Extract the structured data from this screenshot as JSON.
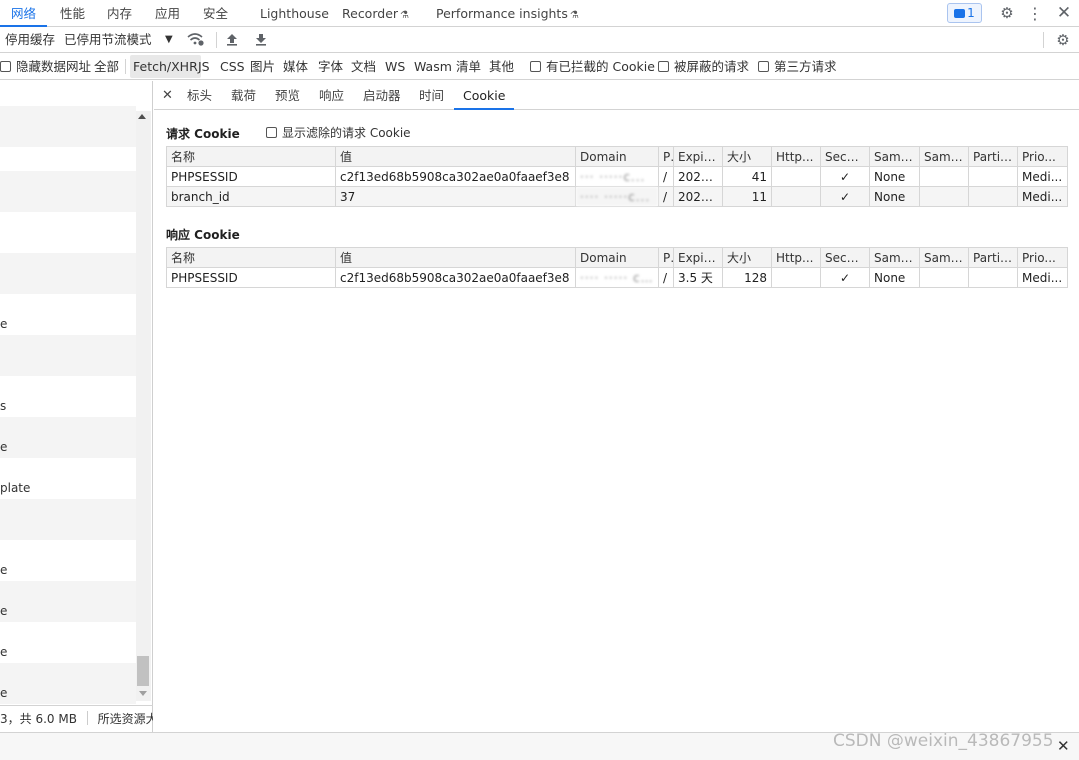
{
  "main_tabs": [
    {
      "label": "网络",
      "active": true
    },
    {
      "label": "性能"
    },
    {
      "label": "内存"
    },
    {
      "label": "应用"
    },
    {
      "label": "安全"
    },
    {
      "label": "Lighthouse"
    },
    {
      "label": "Recorder"
    },
    {
      "label": "Performance insights"
    }
  ],
  "issues_badge": "1",
  "toolbar": {
    "disable_cache": "停用缓存",
    "throttling": "已停用节流模式"
  },
  "filters": [
    {
      "label": "隐藏数据网址",
      "checkbox": true
    },
    {
      "label": "全部"
    },
    {
      "label": "Fetch/XHR",
      "selected": true
    },
    {
      "label": "JS"
    },
    {
      "label": "CSS"
    },
    {
      "label": "图片"
    },
    {
      "label": "媒体"
    },
    {
      "label": "字体"
    },
    {
      "label": "文档"
    },
    {
      "label": "WS"
    },
    {
      "label": "Wasm"
    },
    {
      "label": "清单"
    },
    {
      "label": "其他"
    },
    {
      "label": "有已拦截的 Cookie",
      "checkbox": true
    },
    {
      "label": "被屏蔽的请求",
      "checkbox": true
    },
    {
      "label": "第三方请求",
      "checkbox": true
    }
  ],
  "request_list_fragments": [
    "e",
    "s",
    "e",
    "plate",
    "e",
    "e",
    "e",
    "e"
  ],
  "left_status": "3，共 6.0 MB",
  "left_status2": "所选资源大小",
  "detail_tabs": [
    {
      "label": "标头"
    },
    {
      "label": "载荷"
    },
    {
      "label": "预览"
    },
    {
      "label": "响应"
    },
    {
      "label": "启动器"
    },
    {
      "label": "时间"
    },
    {
      "label": "Cookie",
      "active": true
    }
  ],
  "request_cookies": {
    "title": "请求 Cookie",
    "show_filtered": "显示滤除的请求 Cookie",
    "columns": [
      "名称",
      "值",
      "Domain",
      "P",
      "Expire...",
      "大小",
      "Http...",
      "Secure",
      "Same...",
      "Same...",
      "Partiti...",
      "Prio..."
    ],
    "rows": [
      [
        "PHPSESSID",
        "c2f13ed68b5908ca302ae0a0faaef3e8",
        "··· ·····c...",
        "/",
        "2022-...",
        "41",
        "",
        "✓",
        "None",
        "",
        "",
        "Medi..."
      ],
      [
        "branch_id",
        "37",
        "···· ·····c...",
        "/",
        "2022-...",
        "11",
        "",
        "✓",
        "None",
        "",
        "",
        "Medi..."
      ]
    ]
  },
  "response_cookies": {
    "title": "响应 Cookie",
    "columns": [
      "名称",
      "值",
      "Domain",
      "P",
      "Expire...",
      "大小",
      "Http...",
      "Secure",
      "Same...",
      "Same...",
      "Partiti...",
      "Prio..."
    ],
    "rows": [
      [
        "PHPSESSID",
        "c2f13ed68b5908ca302ae0a0faaef3e8",
        "···· ····· c...",
        "/",
        "3.5 天",
        "128",
        "",
        "✓",
        "None",
        "",
        "",
        "Medi..."
      ]
    ]
  },
  "watermark": "CSDN @weixin_43867955"
}
